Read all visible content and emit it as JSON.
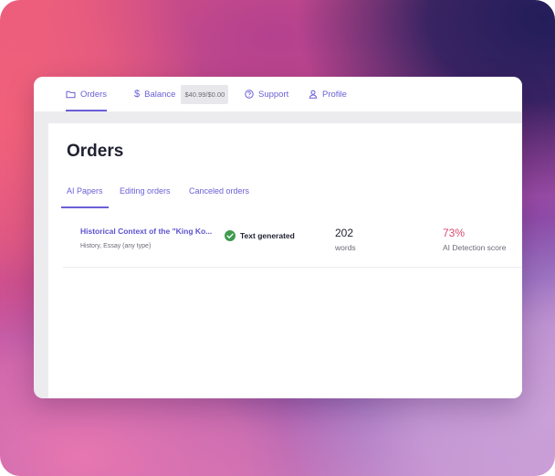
{
  "nav": {
    "orders": {
      "label": "Orders",
      "icon": "folder-icon"
    },
    "balance": {
      "label": "Balance",
      "icon": "dollar-icon",
      "value": "$40.99/$0.00"
    },
    "support": {
      "label": "Support",
      "icon": "help-circle-icon"
    },
    "profile": {
      "label": "Profile",
      "icon": "user-icon"
    }
  },
  "page": {
    "title": "Orders"
  },
  "tabs": [
    {
      "label": "AI Papers",
      "active": true
    },
    {
      "label": "Editing orders",
      "active": false
    },
    {
      "label": "Canceled orders",
      "active": false
    }
  ],
  "orders": [
    {
      "title": "Historical Context of the \"King Ko...",
      "subtitle": "History, Essay (any type)",
      "status": "Text generated",
      "status_icon": "check-circle-icon",
      "words": "202",
      "words_label": "words",
      "score": "73%",
      "score_label": "AI Detection score"
    }
  ],
  "colors": {
    "accent": "#6a5fd6",
    "success": "#3f9b4f",
    "score": "#d94a72"
  }
}
